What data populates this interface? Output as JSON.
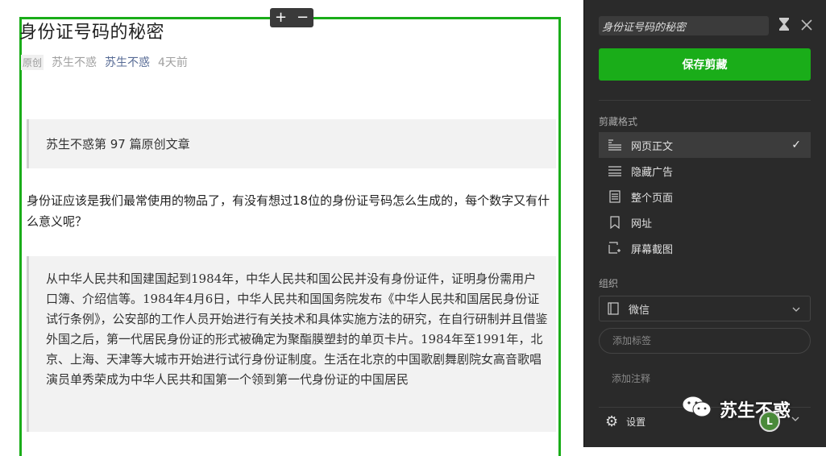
{
  "article": {
    "title": "身份证号码的秘密",
    "badge": "原创",
    "author": "苏生不惑",
    "account": "苏生不惑",
    "time": "4天前",
    "quote1": "苏生不惑第 97 篇原创文章",
    "paragraph": "身份证应该是我们最常使用的物品了，有没有想过18位的身份证号码怎么生成的，每个数字又有什么意义呢？",
    "quote2": "从中华人民共和国建国起到1984年，中华人民共和国公民并没有身份证件，证明身份需用户口簿、介绍信等。1984年4月6日，中华人民共和国国务院发布《中华人民共和国居民身份证试行条例》，公安部的工作人员开始进行有关技术和具体实施方法的研究，在自行研制并且借鉴外国之后，第一代居民身份证的形式被确定为聚酯膜塑封的单页卡片。1984年至1991年，北京、上海、天津等大城市开始进行试行身份证制度。生活在北京的中国歌剧舞剧院女高音歌唱演员单秀荣成为中华人民共和国第一个领到第一代身份证的中国居民"
  },
  "zoom": {
    "plus": "+",
    "minus": "−"
  },
  "panel": {
    "title_value": "身份证号码的秘密",
    "save_label": "保存剪藏",
    "format_label": "剪藏格式",
    "formats": [
      {
        "label": "网页正文",
        "icon": "article-icon",
        "selected": true
      },
      {
        "label": "隐藏广告",
        "icon": "lines-icon",
        "selected": false
      },
      {
        "label": "整个页面",
        "icon": "page-icon",
        "selected": false
      },
      {
        "label": "网址",
        "icon": "bookmark-icon",
        "selected": false
      },
      {
        "label": "屏幕截图",
        "icon": "screenshot-icon",
        "selected": false
      }
    ],
    "org_label": "组织",
    "notebook": "微信",
    "tag_placeholder": "添加标签",
    "note_label": "添加注释",
    "settings_label": "设置"
  },
  "watermark": {
    "text": "苏生不惑"
  },
  "avatar": {
    "letter": "L"
  },
  "colors": {
    "accent": "#1aad19",
    "panel_bg": "#2a2a2a",
    "link": "#576b95"
  }
}
